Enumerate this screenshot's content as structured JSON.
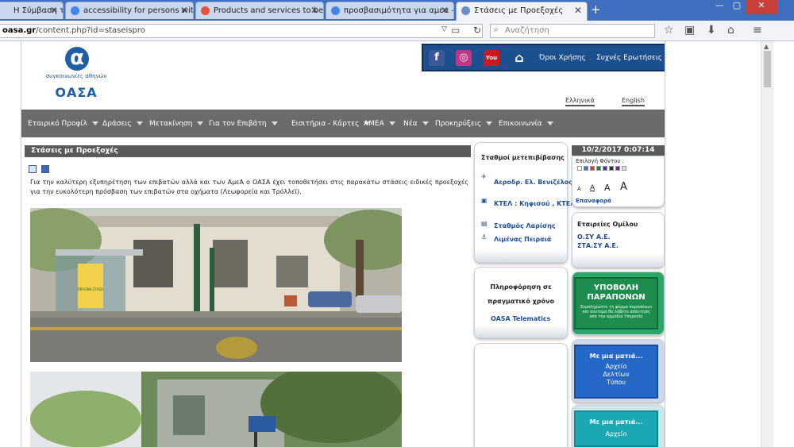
{
  "browser": {
    "tabs": [
      {
        "label": "Η Σύμβαση τ"
      },
      {
        "label": "accessibility for persons wit"
      },
      {
        "label": "Products and services to be"
      },
      {
        "label": "προσβασιμότητα για αμεα -"
      },
      {
        "label": "Στάσεις με Προεξοχές"
      }
    ],
    "url_domain": "oasa.gr",
    "url_path": "/content.php?id=staseispro",
    "search_placeholder": "Αναζήτηση"
  },
  "header": {
    "logo_text_small": "συγκοινωνίες αθηνών",
    "logo_text": "ΟΑΣΑ",
    "top_links": [
      "Όροι Χρήσης",
      "Συχνές Ερωτήσεις"
    ],
    "languages": [
      "Ελληνικά",
      "English"
    ]
  },
  "menu": [
    "Εταιρικό Προφίλ",
    "Δράσεις",
    "Μετακίνηση",
    "Για τον Επιβάτη",
    "Εισιτήρια - Κάρτες",
    "ΑΜΕΑ",
    "Νέα",
    "Προκηρύξεις",
    "Επικοινωνία"
  ],
  "content": {
    "title": "Στάσεις με Προεξοχές",
    "paragraph": "Για την καλύτερη εξυπηρέτηση των επιβατών αλλά και των ΑμεΑ ο ΟΑΣΑ έχει τοποθετήσει στις παρακάτω στάσεις ειδικές προεξοχές για την ευκολότερη πρόσβαση των επιβατών στα οχήματα (Λεωφορεία και Τρόλλεϊ).",
    "shelter_text": "ΠΡΑΣΙΝΗ ΣΤΑΣΗ"
  },
  "stations": {
    "title": "Σταθμοί μετεπιβίβασης",
    "links": [
      "Αεροδρ. Ελ. Βενιζέλος",
      "ΚΤΕΛ : Κηφισού , ΚΤΕΛ : Λιοσίων",
      "Σταθμός Λαρίσης",
      "Λιμένας Πειραιά"
    ]
  },
  "realtime": {
    "title": "Πληροφόρηση σε πραγματικό χρόνο",
    "link": "OASA Telematics"
  },
  "sidebar": {
    "datetime": "10/2/2017 0:07:14",
    "font_color_label": "Επιλογή Φόντου :",
    "font_sizes": [
      "A",
      "A",
      "A",
      "A"
    ],
    "reset_label": "Επαναφορά",
    "group_title": "Εταιρείες Ομίλου",
    "group_links": [
      "Ο.ΣΥ Α.Ε.",
      "ΣΤΑ.ΣΥ Α.Ε."
    ],
    "complaints": {
      "title": "ΥΠΟΒΟΛΗ ΠΑΡΑΠΟΝΩΝ",
      "subtitle": "Συμπληρώστε τη φόρμα παραπόνων και σύντομα θα λάβετε απάντηση από την αρμόδια Υπηρεσία"
    },
    "press": {
      "title": "Με μια ματιά...",
      "subtitle": "Αρχείο Δελτίων Τύπου"
    },
    "archive": {
      "title": "Με μια ματιά...",
      "subtitle": "Αρχείο"
    }
  }
}
